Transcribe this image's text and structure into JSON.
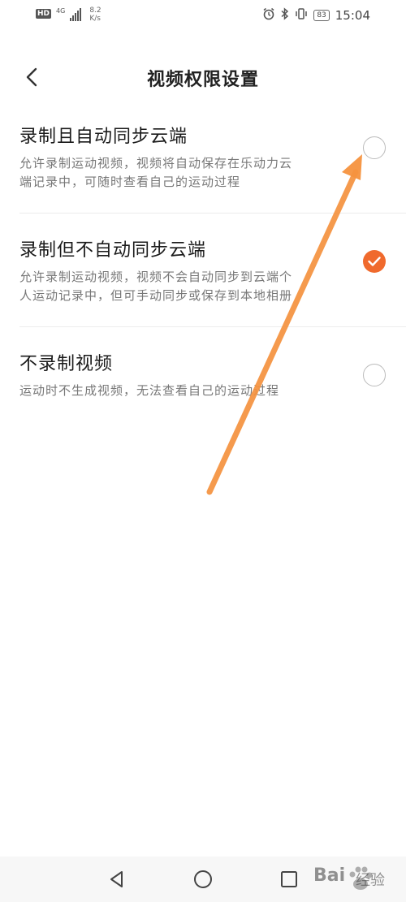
{
  "status_bar": {
    "hd": "HD",
    "network": "4G",
    "speed_value": "8.2",
    "speed_unit": "K/s",
    "battery": "83",
    "time": "15:04",
    "icons": [
      "alarm-icon",
      "bluetooth-icon",
      "vibrate-icon"
    ]
  },
  "header": {
    "title": "视频权限设置",
    "back_icon": "chevron-left-icon"
  },
  "options": [
    {
      "title": "录制且自动同步云端",
      "desc_line1": "允许录制运动视频，视频将自动保存在乐动力云",
      "desc_line2": "端记录中，可随时查看自己的运动过程",
      "selected": false
    },
    {
      "title": "录制但不自动同步云端",
      "desc_line1": "允许录制运动视频，视频不会自动同步到云端个",
      "desc_line2": "人运动记录中，但可手动同步或保存到本地相册",
      "selected": true
    },
    {
      "title": "不录制视频",
      "desc_line1": "运动时不生成视频，无法查看自己的运动过程",
      "desc_line2": "",
      "selected": false
    }
  ],
  "colors": {
    "accent": "#f06a2d",
    "annotation_arrow": "#f5923e"
  },
  "navbar": {
    "icons": [
      "back-triangle-icon",
      "home-circle-icon",
      "recents-square-icon"
    ]
  },
  "watermark": {
    "text": "Bai",
    "suffix": "经验"
  }
}
